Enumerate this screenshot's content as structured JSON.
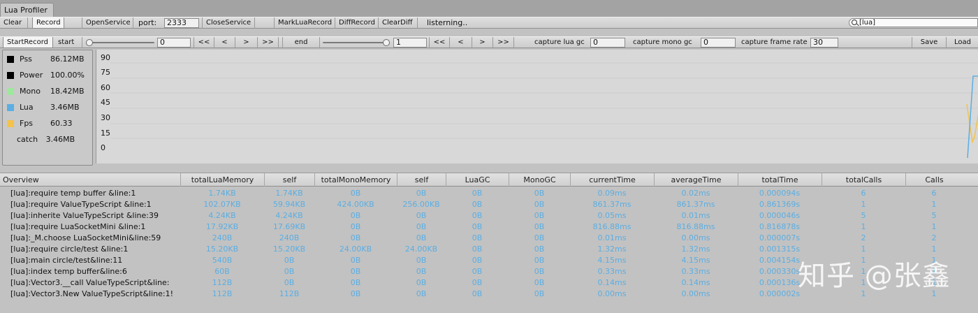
{
  "window": {
    "title": "Lua Profiler"
  },
  "toolbar1": {
    "clear": "Clear",
    "record": "Record",
    "open_service": "OpenService",
    "port_label": "port:",
    "port_value": "2333",
    "close_service": "CloseService",
    "mark_lua_record": "MarkLuaRecord",
    "diff_record": "DiffRecord",
    "clear_diff": "ClearDiff",
    "status": "listerning..",
    "search_value": "[lua]"
  },
  "toolbar2": {
    "start_record": "StartRecord",
    "start_label": "start",
    "start_value": "0",
    "start_slider_level": 0,
    "nav_first": "<<",
    "nav_prev": "<",
    "nav_next": ">",
    "nav_last": ">>",
    "end_label": "end",
    "end_value": "1",
    "end_slider_level": 1,
    "nav2_first": "<<",
    "nav2_prev": "<",
    "nav2_next": ">",
    "nav2_last": ">>",
    "capture_lua_gc_label": "capture lua gc",
    "capture_lua_gc_value": "0",
    "capture_mono_gc_label": "capture mono gc",
    "capture_mono_gc_value": "0",
    "capture_frame_rate_label": "capture frame rate",
    "capture_frame_rate_value": "30",
    "save": "Save",
    "load": "Load"
  },
  "legend": {
    "items": [
      {
        "name": "Pss",
        "value": "86.12MB",
        "color": "#000000"
      },
      {
        "name": "Power",
        "value": "100.00%",
        "color": "#000000"
      },
      {
        "name": "Mono",
        "value": "18.42MB",
        "color": "#9de89a"
      },
      {
        "name": "Lua",
        "value": "3.46MB",
        "color": "#5aaee3"
      },
      {
        "name": "Fps",
        "value": "60.33",
        "color": "#f5c24a"
      }
    ],
    "catch_label": "catch",
    "catch_value": "3.46MB"
  },
  "graph": {
    "y_ticks": [
      "90",
      "75",
      "60",
      "45",
      "30",
      "15",
      "0"
    ]
  },
  "table": {
    "columns": [
      "Overview",
      "totalLuaMemory",
      "self",
      "totalMonoMemory",
      "self",
      "LuaGC",
      "MonoGC",
      "currentTime",
      "averageTime",
      "totalTime",
      "totalCalls",
      "Calls"
    ],
    "rows": [
      [
        "[lua]:require temp buffer &line:1",
        "1.74KB",
        "1.74KB",
        "0B",
        "0B",
        "0B",
        "0B",
        "0.09ms",
        "0.02ms",
        "0.000094s",
        "6",
        "6"
      ],
      [
        "[lua]:require ValueTypeScript &line:1",
        "102.07KB",
        "59.94KB",
        "424.00KB",
        "256.00KB",
        "0B",
        "0B",
        "861.37ms",
        "861.37ms",
        "0.861369s",
        "1",
        "1"
      ],
      [
        "[lua]:inherite ValueTypeScript &line:39",
        "4.24KB",
        "4.24KB",
        "0B",
        "0B",
        "0B",
        "0B",
        "0.05ms",
        "0.01ms",
        "0.000046s",
        "5",
        "5"
      ],
      [
        "[lua]:require LuaSocketMini &line:1",
        "17.92KB",
        "17.69KB",
        "0B",
        "0B",
        "0B",
        "0B",
        "816.88ms",
        "816.88ms",
        "0.816878s",
        "1",
        "1"
      ],
      [
        "[lua]:_M.choose LuaSocketMini&line:59",
        "240B",
        "240B",
        "0B",
        "0B",
        "0B",
        "0B",
        "0.01ms",
        "0.00ms",
        "0.000007s",
        "2",
        "2"
      ],
      [
        "[lua]:require circle/test &line:1",
        "15.20KB",
        "15.20KB",
        "24.00KB",
        "24.00KB",
        "0B",
        "0B",
        "1.32ms",
        "1.32ms",
        "0.001315s",
        "1",
        "1"
      ],
      [
        "[lua]:main circle/test&line:11",
        "540B",
        "0B",
        "0B",
        "0B",
        "0B",
        "0B",
        "4.15ms",
        "4.15ms",
        "0.004154s",
        "1",
        "1"
      ],
      [
        "[lua]:index temp buffer&line:6",
        "60B",
        "0B",
        "0B",
        "0B",
        "0B",
        "0B",
        "0.33ms",
        "0.33ms",
        "0.000330s",
        "1",
        "1"
      ],
      [
        "[lua]:Vector3.__call ValueTypeScript&line:",
        "112B",
        "0B",
        "0B",
        "0B",
        "0B",
        "0B",
        "0.14ms",
        "0.14ms",
        "0.000136s",
        "1",
        "1"
      ],
      [
        "[lua]:Vector3.New ValueTypeScript&line:1!",
        "112B",
        "112B",
        "0B",
        "0B",
        "0B",
        "0B",
        "0.00ms",
        "0.00ms",
        "0.000002s",
        "1",
        "1"
      ]
    ]
  },
  "watermark": "知乎 @张鑫"
}
